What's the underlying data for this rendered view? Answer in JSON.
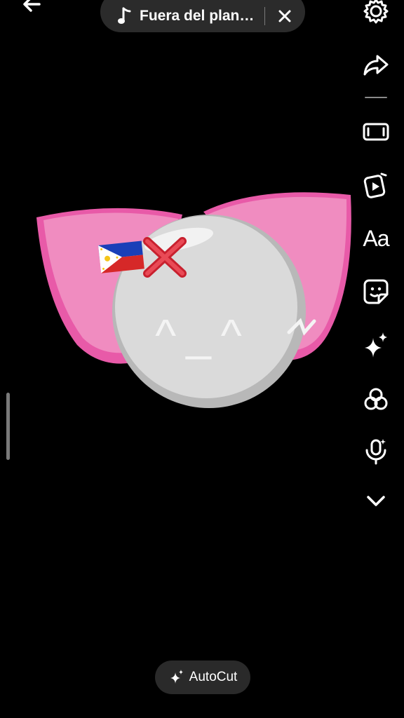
{
  "top_bar": {
    "back_icon": "arrow-left-icon",
    "sound": {
      "icon": "music-note-icon",
      "title": "Fuera del plan…",
      "close_icon": "close-icon"
    },
    "settings_icon": "gear-icon"
  },
  "side_toolbar": {
    "items": [
      {
        "icon": "share-arrow-icon"
      },
      {
        "icon": "aspect-ratio-icon"
      },
      {
        "icon": "templates-icon"
      },
      {
        "icon": "text-icon",
        "label": "Aa"
      },
      {
        "icon": "sticker-icon"
      },
      {
        "icon": "effects-sparkle-icon"
      },
      {
        "icon": "filters-icon"
      },
      {
        "icon": "voice-effects-icon"
      },
      {
        "icon": "chevron-down-icon"
      }
    ]
  },
  "canvas": {
    "face_text": "^_^",
    "colors": {
      "pink": "#f08cc0",
      "pink_dark": "#e85aa8",
      "ball": "#d9d9d9",
      "ball_rim": "#b8b8b8",
      "cross": "#e03040"
    }
  },
  "autocut": {
    "icon": "sparkle-icon",
    "label": "AutoCut"
  }
}
